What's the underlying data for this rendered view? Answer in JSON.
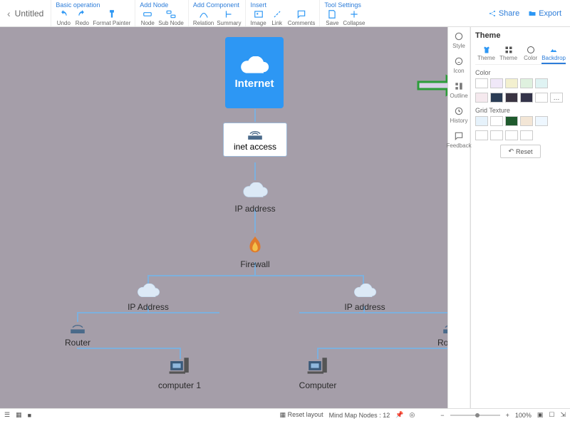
{
  "title": "Untitled",
  "toolbar": {
    "groups": [
      {
        "name": "Basic operation",
        "items": [
          "Undo",
          "Redo",
          "Format Painter"
        ]
      },
      {
        "name": "Add Node",
        "items": [
          "Node",
          "Sub Node"
        ]
      },
      {
        "name": "Add Component",
        "items": [
          "Relation",
          "Summary"
        ]
      },
      {
        "name": "Insert",
        "items": [
          "Image",
          "Link",
          "Comments"
        ]
      },
      {
        "name": "Tool Settings",
        "items": [
          "Save",
          "Collapse"
        ]
      }
    ],
    "share": "Share",
    "export": "Export"
  },
  "mini_tabs": [
    "Style",
    "Icon",
    "Outline",
    "History",
    "Feedback"
  ],
  "panel": {
    "title": "Theme",
    "tabs": [
      "Theme",
      "Theme",
      "Color",
      "Backdrop"
    ],
    "active_tab": 3,
    "color_label": "Color",
    "texture_label": "Grid Texture",
    "reset": "Reset",
    "colors_row1": [
      "#fff",
      "#f0e8f8",
      "#f3f0cf",
      "#dff1df",
      "#dff3f3"
    ],
    "colors_row2": [
      "#f5e9ee",
      "#2b3d55",
      "#3a3442",
      "#34344a",
      "#ffffff"
    ],
    "textures1": [
      "#e6f2fb",
      "#ffffff",
      "#1f5a2d",
      "#f3e6d6",
      "#eef7ff"
    ],
    "textures2": [
      "#ffffff",
      "#ffffff",
      "#ffffff",
      "#ffffff"
    ]
  },
  "status": {
    "reset_layout": "Reset layout",
    "nodes_label": "Mind Map Nodes :",
    "nodes_count": "12",
    "zoom": "100%"
  },
  "diagram": {
    "internet": "Internet",
    "inet": "inet access",
    "ip1": "IP address",
    "firewall": "Firewall",
    "ipL": "IP Address",
    "ipR": "IP address",
    "routerL": "Router",
    "routerR": "Router",
    "comp1": "computer 1",
    "comp2": "Computer"
  }
}
